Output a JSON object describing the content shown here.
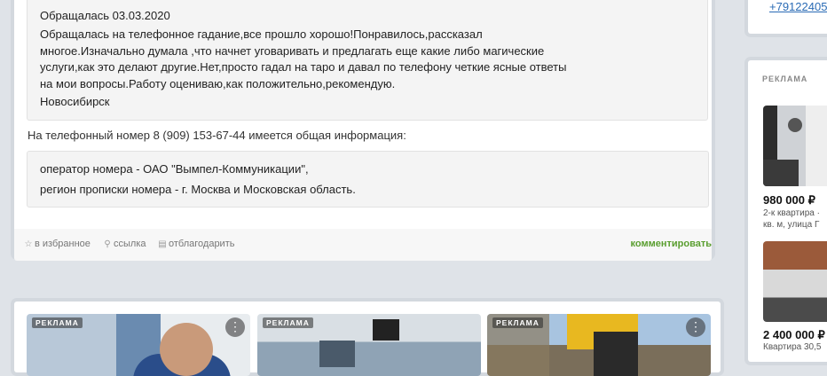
{
  "review": {
    "date": "Обращалась 03.03.2020",
    "lines": [
      "Обращалась на телефонное гадание,все прошло хорошо!Понравилось,рассказал",
      "многое.Изначально думала ,что начнет уговаривать и предлагать еще какие либо магические",
      "услуги,как это делают другие.Нет,просто гадал на таро и давал по телефону четкие ясные ответы",
      "на мои вопросы.Работу оцениваю,как положительно,рекомендую."
    ],
    "city": "Новосибирск"
  },
  "phone_info": {
    "intro": "На телефонный номер 8 (909) 153-67-44 имеется общая информация:",
    "operator": "оператор номера - ОАО \"Вымпел-Коммуникации\",",
    "region": "регион прописки номера - г. Москва и Московская область."
  },
  "actions": {
    "favorite": "в избранное",
    "link": "ссылка",
    "thank": "отблагодарить",
    "comment": "комментировать"
  },
  "sidebar": {
    "phone_link": "+79122405",
    "ad_label": "РЕКЛАМА",
    "listings": [
      {
        "price": "980 000 ₽",
        "desc1": "2-к квартира ·",
        "desc2": "кв. м, улица Г"
      },
      {
        "price": "2 400 000 ₽",
        "desc1": "Квартира 30,5"
      }
    ]
  },
  "bottom_ads": {
    "label": "РЕКЛАМА",
    "more": "⋮"
  },
  "colors": {
    "comment_green": "#5a9e2f",
    "link_blue": "#2a6bb5",
    "page_bg": "#dfe3e8"
  }
}
